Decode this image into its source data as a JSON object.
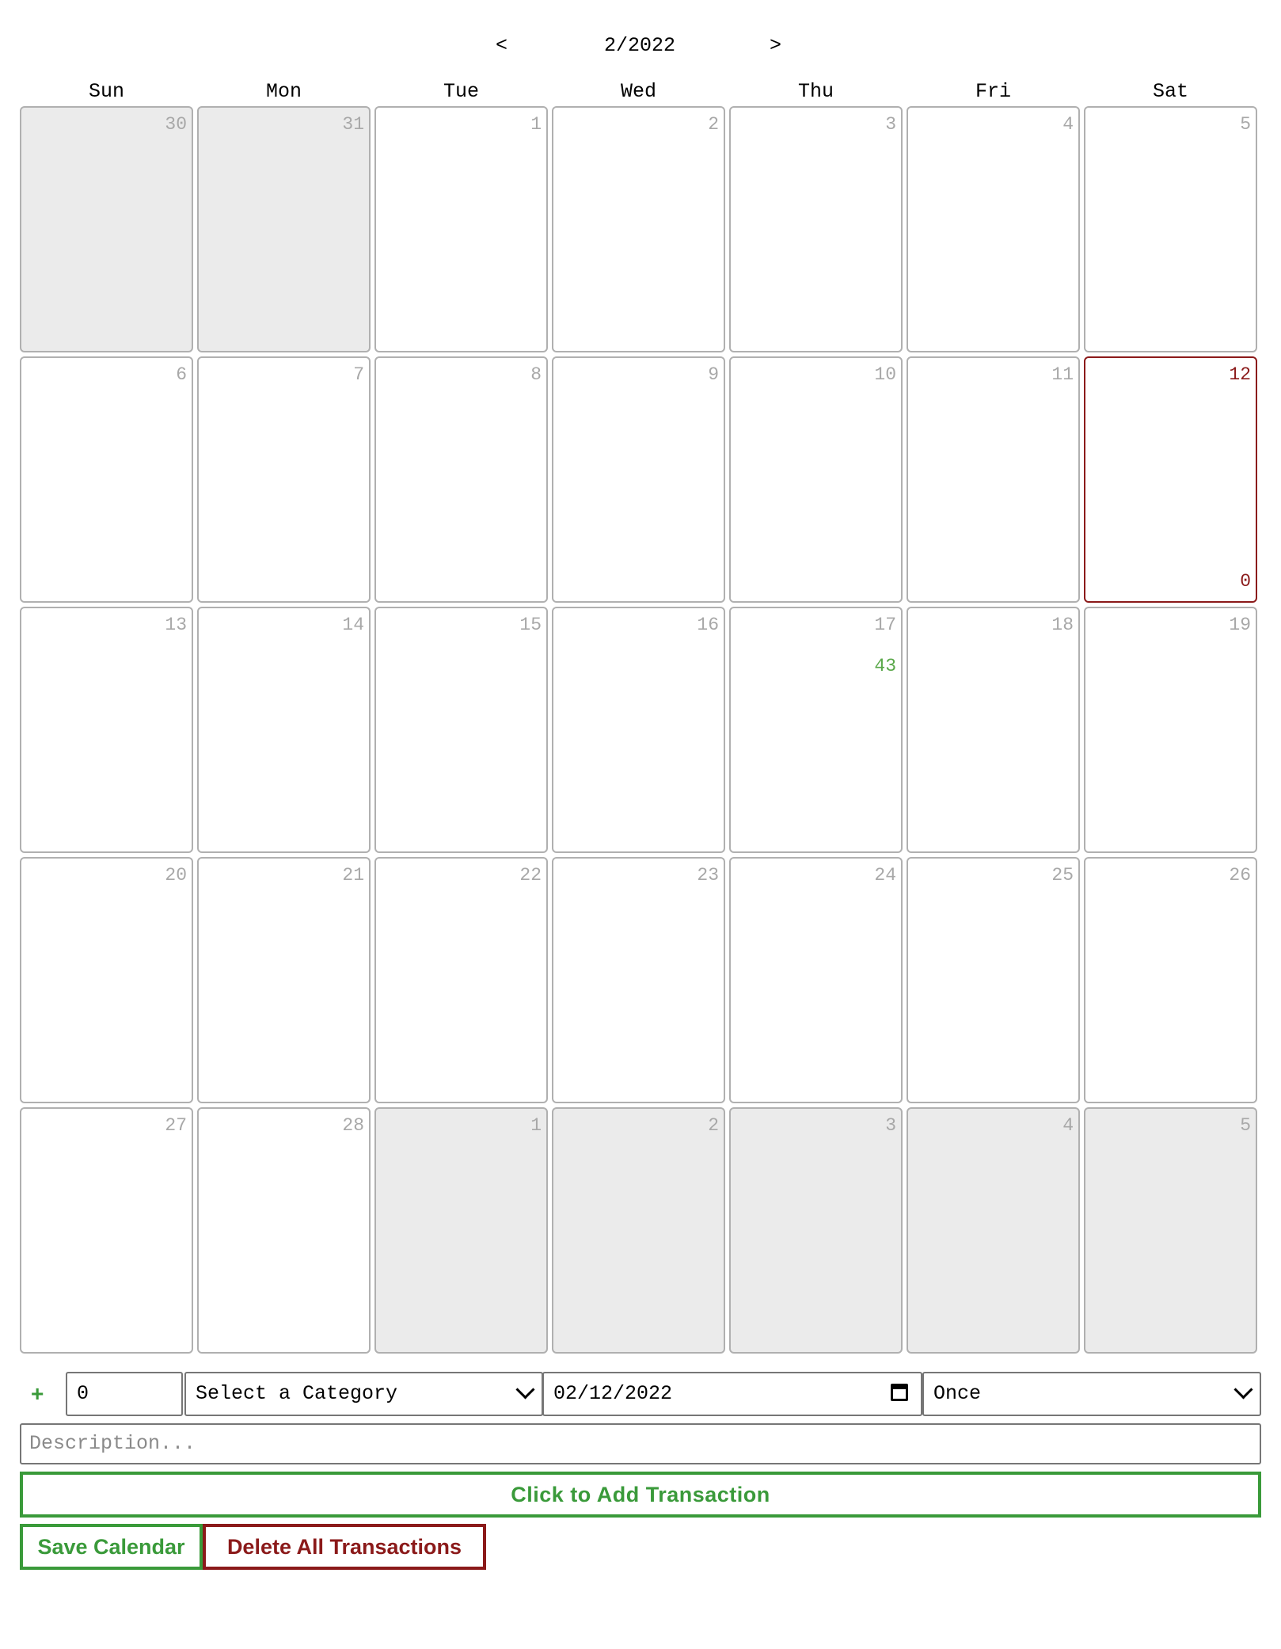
{
  "nav": {
    "prev": "<",
    "month": "2/2022",
    "next": ">"
  },
  "weekdays": [
    "Sun",
    "Mon",
    "Tue",
    "Wed",
    "Thu",
    "Fri",
    "Sat"
  ],
  "weeks": [
    [
      {
        "day": "30",
        "other": true
      },
      {
        "day": "31",
        "other": true
      },
      {
        "day": "1"
      },
      {
        "day": "2"
      },
      {
        "day": "3"
      },
      {
        "day": "4"
      },
      {
        "day": "5"
      }
    ],
    [
      {
        "day": "6"
      },
      {
        "day": "7"
      },
      {
        "day": "8"
      },
      {
        "day": "9"
      },
      {
        "day": "10"
      },
      {
        "day": "11"
      },
      {
        "day": "12",
        "today": true,
        "amount": "0",
        "amount_kind": "zero"
      }
    ],
    [
      {
        "day": "13"
      },
      {
        "day": "14"
      },
      {
        "day": "15"
      },
      {
        "day": "16"
      },
      {
        "day": "17",
        "amount": "43",
        "amount_kind": "pos"
      },
      {
        "day": "18"
      },
      {
        "day": "19"
      }
    ],
    [
      {
        "day": "20"
      },
      {
        "day": "21"
      },
      {
        "day": "22"
      },
      {
        "day": "23"
      },
      {
        "day": "24"
      },
      {
        "day": "25"
      },
      {
        "day": "26"
      }
    ],
    [
      {
        "day": "27"
      },
      {
        "day": "28"
      },
      {
        "day": "1",
        "other": true
      },
      {
        "day": "2",
        "other": true
      },
      {
        "day": "3",
        "other": true
      },
      {
        "day": "4",
        "other": true
      },
      {
        "day": "5",
        "other": true
      }
    ]
  ],
  "form": {
    "plus": "+",
    "amount": "0",
    "category": "Select a Category",
    "date": "02/12/2022",
    "frequency": "Once",
    "description_placeholder": "Description...",
    "add_label": "Click to Add Transaction",
    "save_label": "Save Calendar",
    "delete_label": "Delete All Transactions"
  },
  "colors": {
    "positive": "#5aa84a",
    "today": "#8b1a1a",
    "other_month_bg": "#ebebeb",
    "add_green": "#3a9a3a",
    "delete_red": "#8b1a1a"
  },
  "icons": {
    "prev": "chevron-left-icon",
    "next": "chevron-right-icon",
    "plus": "plus-icon",
    "date_picker": "calendar-icon",
    "select": "chevron-down-icon"
  }
}
